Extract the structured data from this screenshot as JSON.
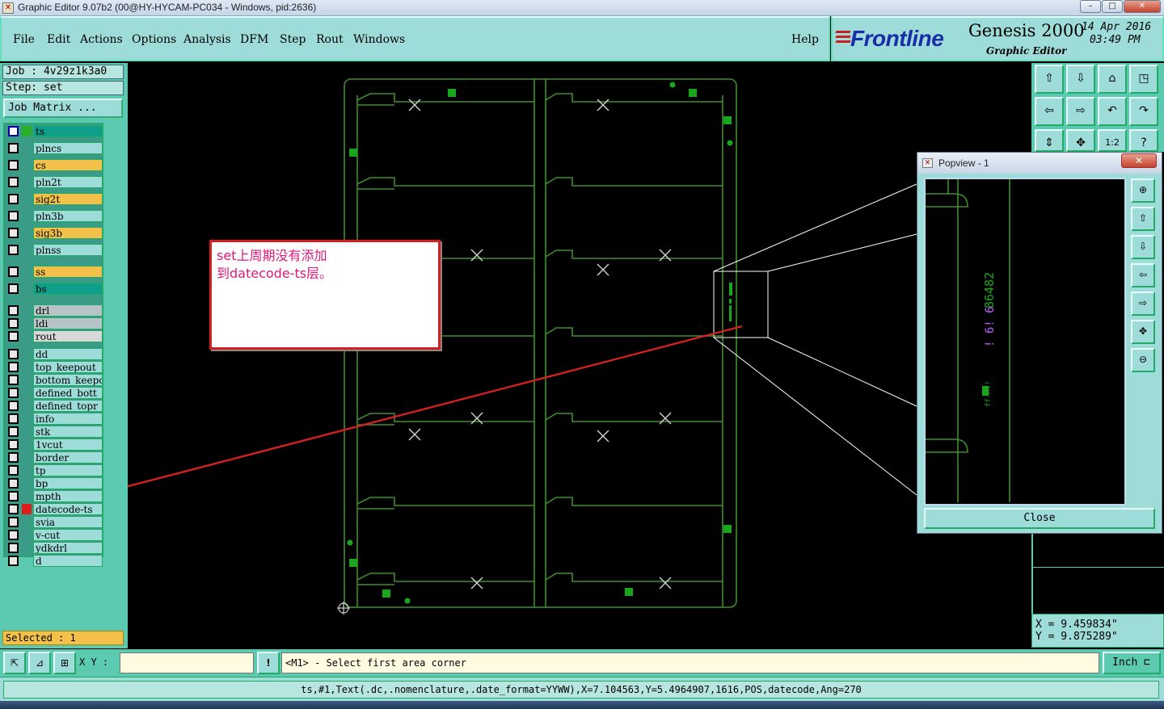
{
  "window": {
    "title": "Graphic Editor 9.07b2 (00@HY-HYCAM-PC034 - Windows, pid:2636)",
    "min_label": "–",
    "max_label": "□",
    "close_label": "✕"
  },
  "menu": {
    "items": [
      {
        "label": "File"
      },
      {
        "label": "Edit"
      },
      {
        "label": "Actions"
      },
      {
        "label": "Options"
      },
      {
        "label": "Analysis"
      },
      {
        "label": "DFM"
      },
      {
        "label": "Step"
      },
      {
        "label": "Rout"
      },
      {
        "label": "Windows"
      }
    ],
    "help": "Help"
  },
  "brand": {
    "logo": "Frontline",
    "product": "Genesis 2000",
    "subtitle": "Graphic Editor",
    "date": "14 Apr 2016",
    "time": "03:49 PM"
  },
  "job": {
    "job_label": "Job : 4v29z1k3a0",
    "step_label": "Step: set",
    "matrix_button": "Job Matrix ..."
  },
  "layers": [
    {
      "name": "ts",
      "color": "#0f9e8a"
    },
    {
      "name": "plncs",
      "color": "#9ddcd9"
    },
    {
      "name": "cs",
      "color": "#f3c04a"
    },
    {
      "name": "pln2t",
      "color": "#9ddcd9"
    },
    {
      "name": "sig2t",
      "color": "#f3c04a"
    },
    {
      "name": "pln3b",
      "color": "#9ddcd9"
    },
    {
      "name": "sig3b",
      "color": "#f3c04a"
    },
    {
      "name": "plnss",
      "color": "#9ddcd9"
    },
    {
      "name": "ss",
      "color": "#f3c04a"
    },
    {
      "name": "bs",
      "color": "#0f9e8a"
    },
    {
      "name": "drl",
      "color": "#b6c4c8"
    },
    {
      "name": "ldi",
      "color": "#b6c4c8"
    },
    {
      "name": "rout",
      "color": "#d8d8d8"
    },
    {
      "name": "dd",
      "color": "#9ddcd9"
    },
    {
      "name": "top_keepout",
      "color": "#9ddcd9"
    },
    {
      "name": "bottom_keepo",
      "color": "#9ddcd9"
    },
    {
      "name": "defined_bott",
      "color": "#9ddcd9"
    },
    {
      "name": "defined_topr",
      "color": "#9ddcd9"
    },
    {
      "name": "info",
      "color": "#9ddcd9"
    },
    {
      "name": "stk",
      "color": "#9ddcd9"
    },
    {
      "name": "1vcut",
      "color": "#9ddcd9"
    },
    {
      "name": "border",
      "color": "#9ddcd9"
    },
    {
      "name": "tp",
      "color": "#9ddcd9"
    },
    {
      "name": "bp",
      "color": "#9ddcd9"
    },
    {
      "name": "mpth",
      "color": "#9ddcd9"
    },
    {
      "name": "datecode-ts",
      "color": "#9ddcd9",
      "marked": true
    },
    {
      "name": "svia",
      "color": "#9ddcd9"
    },
    {
      "name": "v-cut",
      "color": "#9ddcd9"
    },
    {
      "name": "ydkdrl",
      "color": "#9ddcd9"
    },
    {
      "name": "d",
      "color": "#9ddcd9"
    }
  ],
  "selected_status": "Selected : 1",
  "annotation": {
    "text": "set上周期没有添加\n到datecode-ts层。"
  },
  "popview": {
    "title": "Popview - 1",
    "close_label": "Close",
    "x_label": "✕",
    "datecode_text": "86482",
    "datecode_text2": "! 6! 6",
    "small_text": "ff-MT!"
  },
  "coords": {
    "x": "X  =  9.459834\"",
    "y": "Y  =  9.875289\""
  },
  "command": {
    "xy_label": "X Y :",
    "xy_value": "",
    "prompt": "<M1> - Select first area corner",
    "units": "Inch"
  },
  "status_line": "ts,#1,Text(.dc,.nomenclature,.date_format=YYWW),X=7.104563,Y=5.4964907,1616,POS,datecode,Ang=270",
  "colors": {
    "panel": "#5cc9b1",
    "menu": "#9ddcd9",
    "board_outline": "#3d8f2a",
    "pad": "#1aa61a",
    "annotation": "#d32121",
    "annotation_text": "#e0187c"
  }
}
